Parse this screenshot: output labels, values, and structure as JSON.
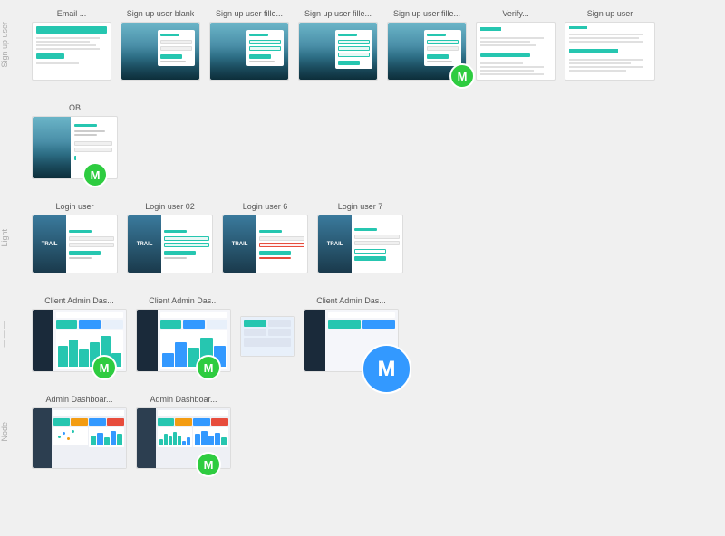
{
  "sections": [
    {
      "id": "signup",
      "label": "Sign up user",
      "frames": [
        {
          "label": "Email ...",
          "type": "email"
        },
        {
          "label": "Sign up user blank",
          "type": "signup-blank"
        },
        {
          "label": "Sign up user fille...",
          "type": "signup-filled1"
        },
        {
          "label": "Sign up user fille...",
          "type": "signup-filled2"
        },
        {
          "label": "Sign up user fille...",
          "type": "signup-filled3"
        },
        {
          "label": "Verify...",
          "type": "verify"
        },
        {
          "label": "Sign up user",
          "type": "signup-final",
          "hasBadge": true
        }
      ]
    },
    {
      "id": "ob",
      "label": "OB",
      "frames": [
        {
          "label": "OB",
          "type": "ob",
          "hasBadge": true
        }
      ]
    },
    {
      "id": "light",
      "label": "Light",
      "frames": [
        {
          "label": "Login user",
          "type": "login"
        },
        {
          "label": "Login user 02",
          "type": "login02"
        },
        {
          "label": "Login user 6",
          "type": "login6"
        },
        {
          "label": "Login user 7",
          "type": "login7"
        }
      ]
    },
    {
      "id": "client-admin",
      "label": "—————",
      "frames": [
        {
          "label": "Client Admin Das...",
          "type": "client-admin1",
          "hasBadge": true
        },
        {
          "label": "Client Admin Das...",
          "type": "client-admin2",
          "hasBadge": true
        },
        {
          "label": "",
          "type": "client-admin-mini"
        },
        {
          "label": "Client Admin Das...",
          "type": "client-admin3",
          "hasBadge": true,
          "badgeLarge": true,
          "badgeBlue": true
        }
      ]
    },
    {
      "id": "node",
      "label": "Node",
      "frames": [
        {
          "label": "Admin Dashboar...",
          "type": "admin-dash1"
        },
        {
          "label": "Admin Dashboar...",
          "type": "admin-dash2",
          "hasBadge": true
        }
      ]
    }
  ],
  "colors": {
    "teal": "#26c6b0",
    "blue": "#3399ff",
    "green": "#2ecc40",
    "dark": "#1a2a3a",
    "sidebar": "#2c3e50"
  },
  "badge": {
    "label": "M"
  }
}
